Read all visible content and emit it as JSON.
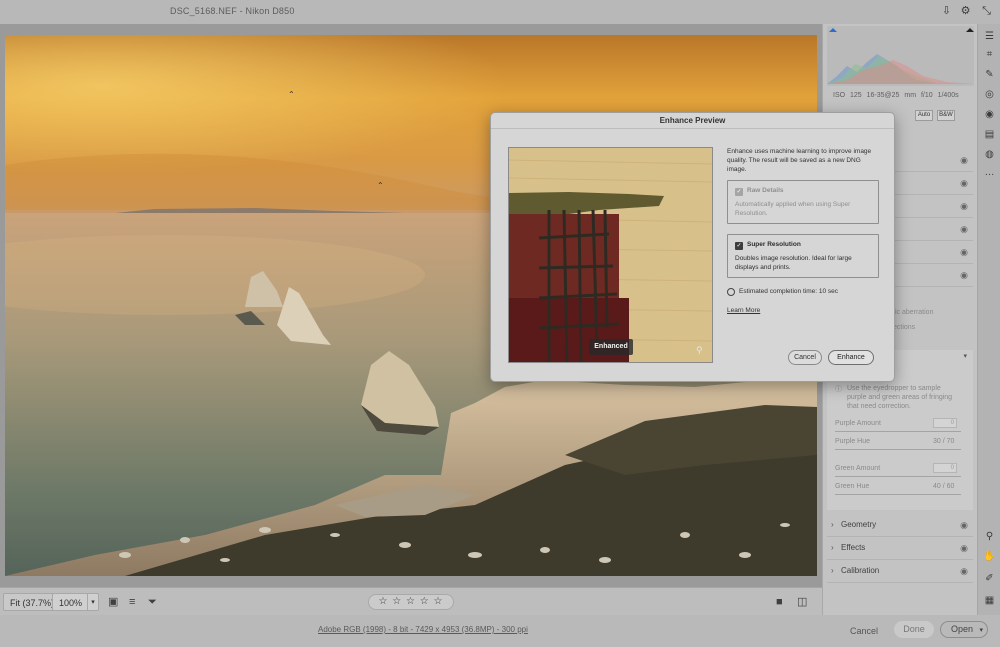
{
  "window": {
    "title": "DSC_5168.NEF  -  Nikon D850"
  },
  "titlebar_icons": [
    "export-icon",
    "gear-icon",
    "collapse-icon"
  ],
  "bottom_bar": {
    "zoom_fit": "Fit (37.7%)",
    "zoom_100": "100%",
    "rating": "☆ ☆ ☆ ☆ ☆"
  },
  "status_bar": {
    "file_info": "Adobe RGB (1998) - 8 bit - 7429 x 4953 (36.8MP) - 300 ppi",
    "cancel": "Cancel",
    "done": "Done",
    "open": "Open"
  },
  "right_panel": {
    "camera_info": "ISO 125   16-35@25 mm   f/10   1/400s",
    "auto_label": "Auto",
    "bw_label": "B&W",
    "fragment_aberration": "tic aberration",
    "fragment_corrections": "ections",
    "color_fringe": {
      "hint": "Use the eyedropper to sample purple and green areas of fringing that need correction.",
      "purple_amount_label": "Purple Amount",
      "purple_amount_value": "0",
      "purple_hue_label": "Purple Hue",
      "purple_hue_value": "30 / 70",
      "green_amount_label": "Green Amount",
      "green_amount_value": "0",
      "green_hue_label": "Green Hue",
      "green_hue_value": "40 / 60"
    },
    "sections": [
      {
        "label": "Geometry"
      },
      {
        "label": "Effects"
      },
      {
        "label": "Calibration"
      }
    ]
  },
  "dialog": {
    "title": "Enhance Preview",
    "description": "Enhance uses machine learning to improve image quality. The result will be saved as a new DNG image.",
    "preview_badge": "Enhanced",
    "raw_details": {
      "title": "Raw Details",
      "description": "Automatically applied when using Super Resolution.",
      "checked": true,
      "enabled": false
    },
    "super_resolution": {
      "title": "Super Resolution",
      "description": "Doubles image resolution. Ideal for large displays and prints.",
      "checked": true,
      "enabled": true
    },
    "estimated_time": "Estimated completion time: 10 sec",
    "learn_more": "Learn More",
    "cancel": "Cancel",
    "enhance": "Enhance"
  }
}
